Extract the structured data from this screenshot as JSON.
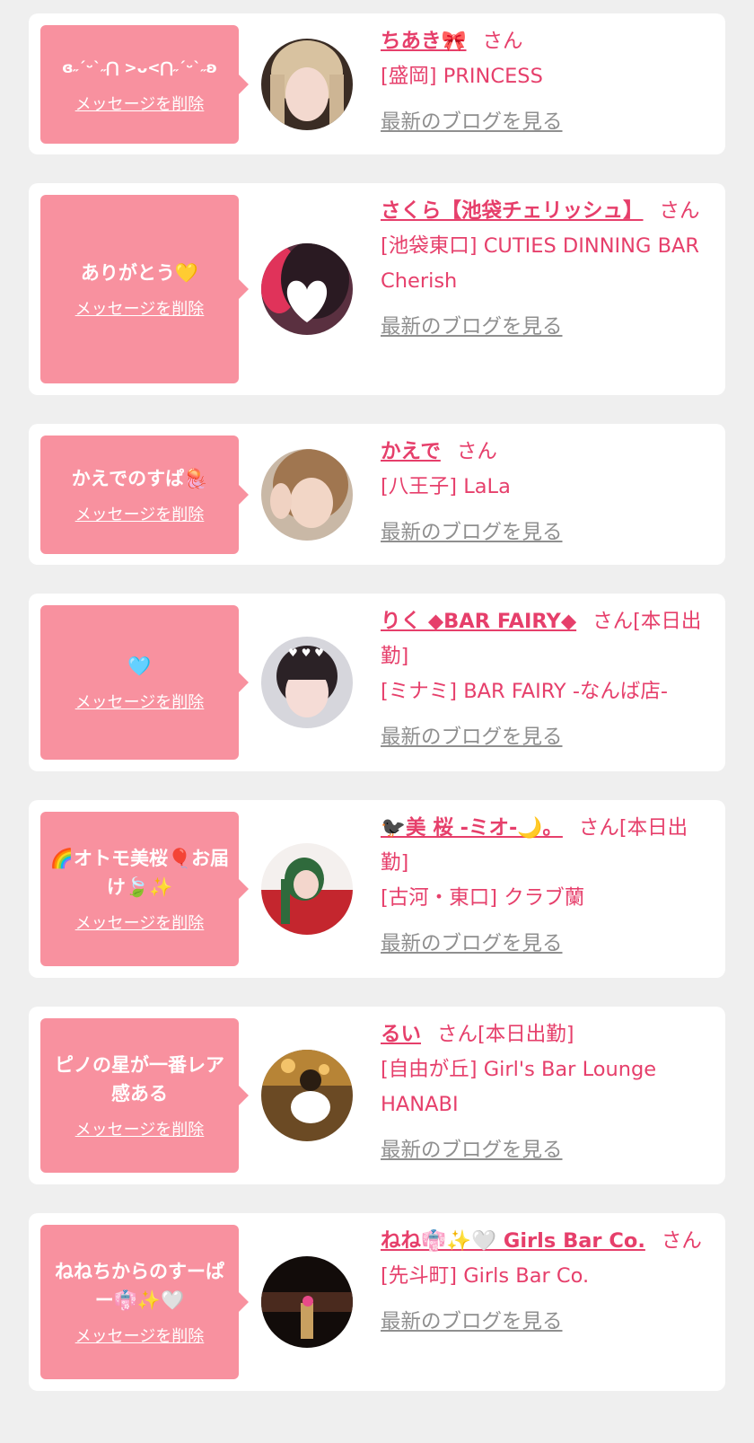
{
  "delete_label": "メッセージを削除",
  "blog_label": "最新のブログを見る",
  "messages": [
    {
      "message": "ɞ˶ˊᵕˋ˶⋂ >ᴗ<⋂˶ˊᵕˋ˶ʚ",
      "name": "ちあき🎀",
      "honorific": "さん",
      "shop": "[盛岡] PRINCESS"
    },
    {
      "message": "ありがとう💛",
      "name": "さくら【池袋チェリッシュ】",
      "honorific": "さん",
      "shop": "[池袋東口] CUTIES DINNING BAR Cherish"
    },
    {
      "message": "かえでのすぱ🪼",
      "name": "かえで",
      "honorific": "さん",
      "shop": "[八王子] LaLa"
    },
    {
      "message": "🩵",
      "name": "りく ◆BAR FAIRY◆",
      "honorific": "さん[本日出勤]",
      "shop": "[ミナミ] BAR FAIRY -なんば店-"
    },
    {
      "message": "🌈オトモ美桜🎈お届け🍃✨",
      "name": "🐦‍⬛美 桜 -ミオ-🌙。",
      "honorific": "さん[本日出勤]",
      "shop": "[古河・東口] クラブ蘭"
    },
    {
      "message": "ピノの星が一番レア感ある",
      "name": "るい",
      "honorific": "さん[本日出勤]",
      "shop": "[自由が丘] Girl's Bar Lounge HANABI"
    },
    {
      "message": "ねねちからのすーぱー👘✨🤍",
      "name": "ねね👘✨🤍 Girls Bar Co.",
      "honorific": "さん",
      "shop": "[先斗町] Girls Bar Co."
    }
  ]
}
